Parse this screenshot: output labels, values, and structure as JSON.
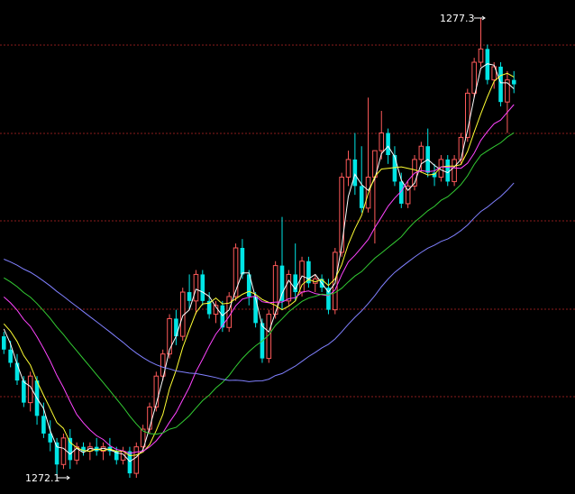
{
  "chart_data": {
    "type": "candlestick",
    "price_range": [
      1272.1,
      1277.3
    ],
    "grid": "horizontal-dashed",
    "annotations": {
      "high": "1277.3",
      "low": "1272.1"
    },
    "colors": {
      "background": "#000000",
      "grid": "#8b1c1c",
      "up_candle": "#ff5a5a",
      "down_candle": "#00e5e5",
      "ma_fast": "#ffffff",
      "ma_2": "#ffff33",
      "ma_3": "#ff44ff",
      "ma_4": "#33cc33",
      "ma_5": "#8080ff"
    },
    "candles": [
      [
        1273.7,
        1273.75,
        1273.5,
        1273.55
      ],
      [
        1273.55,
        1273.65,
        1273.35,
        1273.4
      ],
      [
        1273.4,
        1273.5,
        1273.15,
        1273.2
      ],
      [
        1273.2,
        1273.25,
        1272.9,
        1272.95
      ],
      [
        1272.95,
        1273.3,
        1272.85,
        1273.25
      ],
      [
        1273.2,
        1273.25,
        1272.7,
        1272.8
      ],
      [
        1272.8,
        1272.95,
        1272.55,
        1272.6
      ],
      [
        1272.6,
        1272.75,
        1272.4,
        1272.5
      ],
      [
        1272.5,
        1272.55,
        1272.1,
        1272.25
      ],
      [
        1272.25,
        1272.6,
        1272.2,
        1272.55
      ],
      [
        1272.55,
        1272.65,
        1272.2,
        1272.3
      ],
      [
        1272.3,
        1272.5,
        1272.25,
        1272.45
      ],
      [
        1272.45,
        1272.5,
        1272.35,
        1272.4
      ],
      [
        1272.4,
        1272.5,
        1272.3,
        1272.45
      ],
      [
        1272.45,
        1272.55,
        1272.35,
        1272.4
      ],
      [
        1272.4,
        1272.5,
        1272.3,
        1272.45
      ],
      [
        1272.45,
        1272.55,
        1272.35,
        1272.4
      ],
      [
        1272.4,
        1272.45,
        1272.25,
        1272.3
      ],
      [
        1272.3,
        1272.45,
        1272.25,
        1272.4
      ],
      [
        1272.4,
        1272.45,
        1272.1,
        1272.15
      ],
      [
        1272.15,
        1272.5,
        1272.1,
        1272.45
      ],
      [
        1272.45,
        1272.7,
        1272.4,
        1272.65
      ],
      [
        1272.65,
        1272.95,
        1272.6,
        1272.9
      ],
      [
        1272.9,
        1273.3,
        1272.85,
        1273.25
      ],
      [
        1273.25,
        1273.55,
        1273.2,
        1273.5
      ],
      [
        1273.5,
        1273.95,
        1273.45,
        1273.9
      ],
      [
        1273.9,
        1274.0,
        1273.6,
        1273.7
      ],
      [
        1273.7,
        1274.25,
        1273.65,
        1274.2
      ],
      [
        1274.2,
        1274.4,
        1274.0,
        1274.1
      ],
      [
        1274.1,
        1274.45,
        1273.95,
        1274.4
      ],
      [
        1274.4,
        1274.45,
        1274.05,
        1274.1
      ],
      [
        1274.1,
        1274.2,
        1273.9,
        1273.95
      ],
      [
        1273.95,
        1274.1,
        1273.85,
        1274.05
      ],
      [
        1274.05,
        1274.1,
        1273.75,
        1273.8
      ],
      [
        1273.8,
        1274.2,
        1273.75,
        1274.15
      ],
      [
        1274.15,
        1274.75,
        1274.1,
        1274.7
      ],
      [
        1274.7,
        1274.8,
        1274.35,
        1274.4
      ],
      [
        1274.4,
        1274.45,
        1274.05,
        1274.15
      ],
      [
        1274.15,
        1274.2,
        1273.8,
        1273.85
      ],
      [
        1273.85,
        1273.9,
        1273.4,
        1273.45
      ],
      [
        1273.45,
        1274.0,
        1273.4,
        1273.95
      ],
      [
        1273.95,
        1274.55,
        1273.9,
        1274.5
      ],
      [
        1274.5,
        1275.05,
        1274.0,
        1274.1
      ],
      [
        1274.1,
        1274.45,
        1274.05,
        1274.4
      ],
      [
        1274.4,
        1274.75,
        1274.1,
        1274.2
      ],
      [
        1274.2,
        1274.6,
        1274.15,
        1274.55
      ],
      [
        1274.55,
        1274.6,
        1274.25,
        1274.3
      ],
      [
        1274.3,
        1274.4,
        1274.2,
        1274.35
      ],
      [
        1274.35,
        1274.4,
        1274.2,
        1274.25
      ],
      [
        1274.25,
        1274.35,
        1273.95,
        1274.0
      ],
      [
        1274.0,
        1274.7,
        1273.95,
        1274.65
      ],
      [
        1274.65,
        1275.55,
        1274.6,
        1275.5
      ],
      [
        1275.5,
        1275.8,
        1275.4,
        1275.7
      ],
      [
        1275.7,
        1276.0,
        1275.3,
        1275.4
      ],
      [
        1275.4,
        1275.85,
        1275.1,
        1275.15
      ],
      [
        1275.15,
        1276.4,
        1275.1,
        1275.5
      ],
      [
        1275.5,
        1275.7,
        1274.75,
        1275.8
      ],
      [
        1275.8,
        1276.25,
        1275.7,
        1276.0
      ],
      [
        1276.0,
        1276.05,
        1275.65,
        1275.75
      ],
      [
        1275.75,
        1275.85,
        1275.4,
        1275.45
      ],
      [
        1275.45,
        1275.55,
        1275.15,
        1275.2
      ],
      [
        1275.2,
        1275.45,
        1275.15,
        1275.4
      ],
      [
        1275.4,
        1275.75,
        1275.35,
        1275.7
      ],
      [
        1275.7,
        1275.9,
        1275.55,
        1275.85
      ],
      [
        1275.85,
        1276.05,
        1275.5,
        1275.55
      ],
      [
        1275.55,
        1275.65,
        1275.4,
        1275.5
      ],
      [
        1275.5,
        1275.75,
        1275.45,
        1275.7
      ],
      [
        1275.7,
        1275.75,
        1275.4,
        1275.45
      ],
      [
        1275.45,
        1275.75,
        1275.4,
        1275.7
      ],
      [
        1275.7,
        1276.0,
        1275.65,
        1275.95
      ],
      [
        1275.95,
        1276.5,
        1275.9,
        1276.45
      ],
      [
        1276.45,
        1276.85,
        1276.4,
        1276.8
      ],
      [
        1276.8,
        1277.3,
        1276.75,
        1276.95
      ],
      [
        1276.95,
        1277.0,
        1276.55,
        1276.6
      ],
      [
        1276.6,
        1276.8,
        1276.5,
        1276.75
      ],
      [
        1276.75,
        1276.8,
        1276.3,
        1276.35
      ],
      [
        1276.35,
        1276.7,
        1276.0,
        1276.6
      ],
      [
        1276.6,
        1276.7,
        1276.45,
        1276.55
      ]
    ]
  }
}
